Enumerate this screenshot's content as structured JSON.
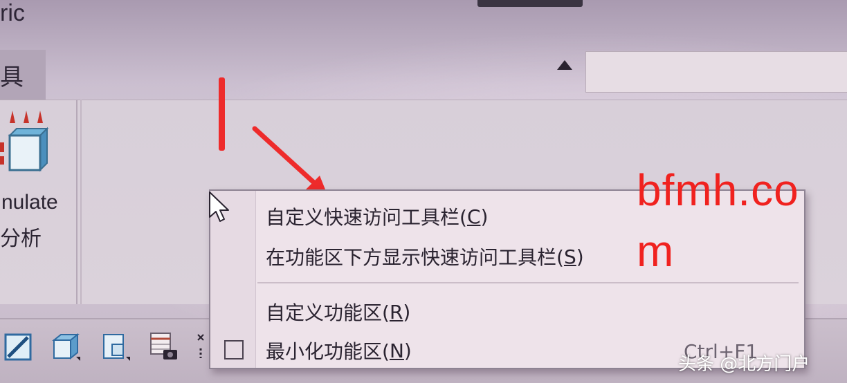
{
  "window": {
    "title_fragment": "ric"
  },
  "ribbon": {
    "tab_fragment": "具",
    "simulate_label": "nulate",
    "simulate_sublabel": "分析"
  },
  "context_menu": {
    "items": [
      {
        "label": "自定义快速访问工具栏(",
        "accel": "C",
        "tail": ")"
      },
      {
        "label": "在功能区下方显示快速访问工具栏(",
        "accel": "S",
        "tail": ")"
      },
      {
        "label": "自定义功能区(",
        "accel": "R",
        "tail": ")"
      },
      {
        "label": "最小化功能区(",
        "accel": "N",
        "tail": ")",
        "shortcut": "Ctrl+F1",
        "checked": false
      }
    ]
  },
  "annotations": {
    "watermark_line1": "bfmh.co",
    "watermark_line2": "m",
    "credit": "头条 @北方门户",
    "accent_color": "#ee2b2b"
  },
  "icons": {
    "collapse": "chevron-up-icon",
    "qat": [
      "edit-sketch-icon",
      "cube-part-icon",
      "drawing-sheet-icon",
      "table-camera-icon",
      "misc-icon"
    ]
  }
}
